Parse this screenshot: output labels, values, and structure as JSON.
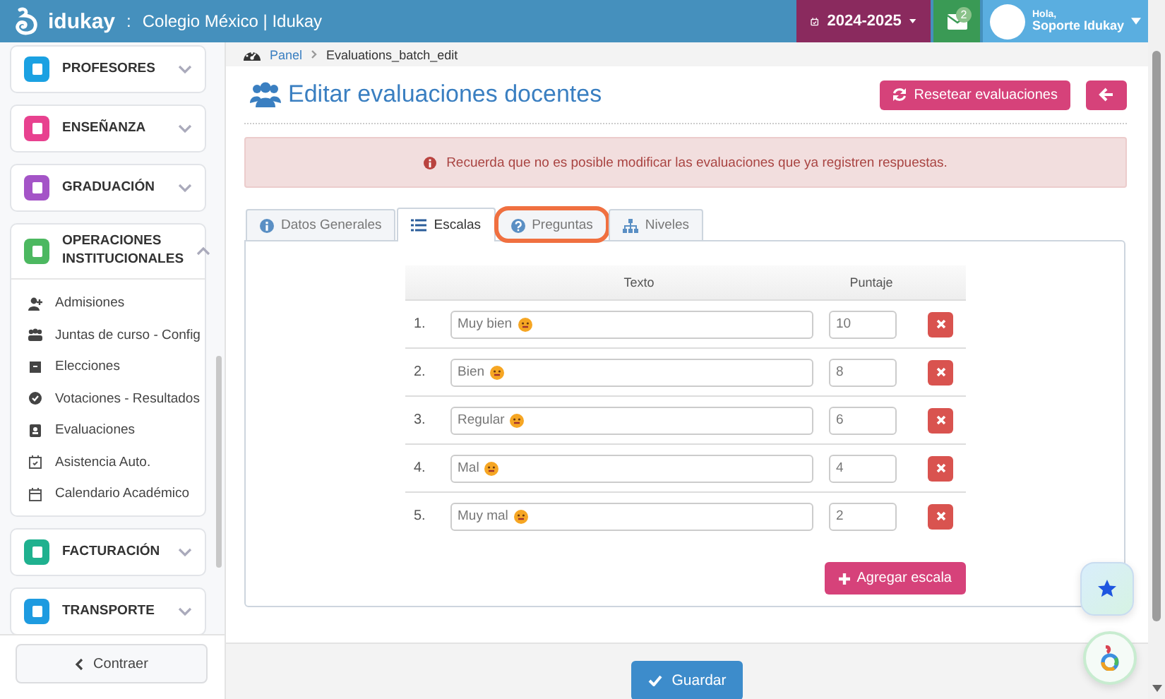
{
  "topbar": {
    "brand": "idukay",
    "separator": ":",
    "school": "Colegio México | Idukay",
    "year": "2024-2025",
    "messages_badge": "2",
    "greeting": "Hola,",
    "user": "Soporte Idukay"
  },
  "sidebar": {
    "sections": [
      {
        "label": "PROFESORES",
        "color": "#1ba1e2",
        "expanded": false
      },
      {
        "label": "ENSEÑANZA",
        "color": "#e8418f",
        "expanded": false
      },
      {
        "label": "GRADUACIÓN",
        "color": "#a454c7",
        "expanded": false
      },
      {
        "label": "OPERACIONES INSTITUCIONALES",
        "color": "#4cb860",
        "expanded": true,
        "items": [
          "Admisiones",
          "Juntas de curso - Config",
          "Elecciones",
          "Votaciones - Resultados",
          "Evaluaciones",
          "Asistencia Auto.",
          "Calendario Académico"
        ]
      },
      {
        "label": "FACTURACIÓN",
        "color": "#1fb18f",
        "expanded": false
      },
      {
        "label": "TRANSPORTE",
        "color": "#1e9be0",
        "expanded": false
      }
    ],
    "collapse": "Contraer"
  },
  "breadcrumb": [
    "Panel",
    "Evaluations_batch_edit"
  ],
  "page": {
    "title": "Editar evaluaciones docentes",
    "reset_button": "Resetear evaluaciones"
  },
  "alert": "Recuerda que no es posible modificar las evaluaciones que ya registren respuestas.",
  "tabs": [
    {
      "label": "Datos Generales",
      "selected": false,
      "highlighted": false
    },
    {
      "label": "Escalas",
      "selected": true,
      "highlighted": false
    },
    {
      "label": "Preguntas",
      "selected": false,
      "highlighted": true
    },
    {
      "label": "Niveles",
      "selected": false,
      "highlighted": false
    }
  ],
  "scales": {
    "columns": [
      "Texto",
      "Puntaje"
    ],
    "rows": [
      {
        "number": "1.",
        "text": "Muy bien",
        "score": "10"
      },
      {
        "number": "2.",
        "text": "Bien",
        "score": "8"
      },
      {
        "number": "3.",
        "text": "Regular",
        "score": "6"
      },
      {
        "number": "4.",
        "text": "Mal",
        "score": "4"
      },
      {
        "number": "5.",
        "text": "Muy mal",
        "score": "2"
      }
    ]
  },
  "add_button": "Agregar escala",
  "save_button": "Guardar"
}
